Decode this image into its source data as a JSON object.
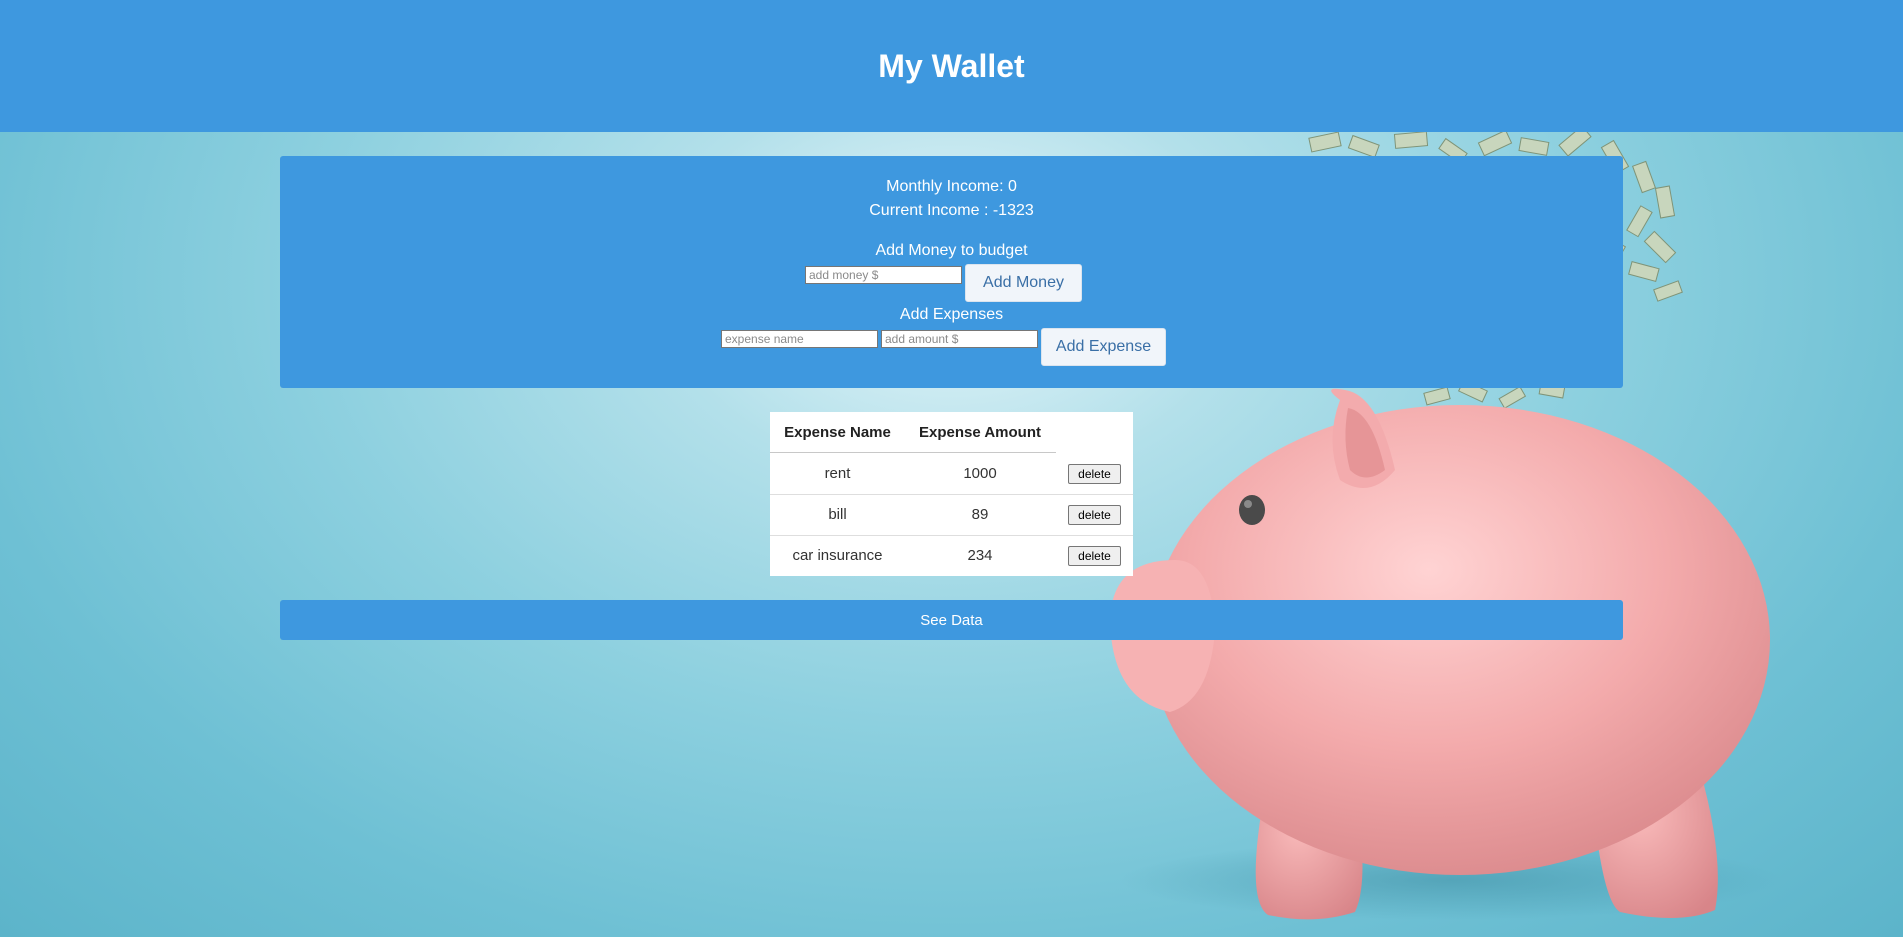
{
  "header": {
    "title": "My Wallet"
  },
  "summary": {
    "monthly_income": "Monthly Income: 0",
    "current_income": "Current Income : -1323"
  },
  "add_money": {
    "heading": "Add Money to budget",
    "placeholder": "add money $",
    "button_label": "Add Money"
  },
  "add_expenses": {
    "heading": "Add Expenses",
    "name_placeholder": "expense name",
    "amount_placeholder": "add amount $",
    "button_label": "Add Expense"
  },
  "expense_table": {
    "headers": [
      "Expense Name",
      "Expense Amount"
    ],
    "rows": [
      {
        "name": "rent",
        "amount": "1000",
        "action": "delete"
      },
      {
        "name": "bill",
        "amount": "89",
        "action": "delete"
      },
      {
        "name": "car insurance",
        "amount": "234",
        "action": "delete"
      }
    ]
  },
  "see_data": {
    "label": "See Data"
  },
  "colors": {
    "accent": "#3e98df",
    "background": "#8dd0df",
    "piggy": "#f2a6a8"
  },
  "background_art": [
    "piggy-bank-illustration",
    "falling-money-bills"
  ]
}
